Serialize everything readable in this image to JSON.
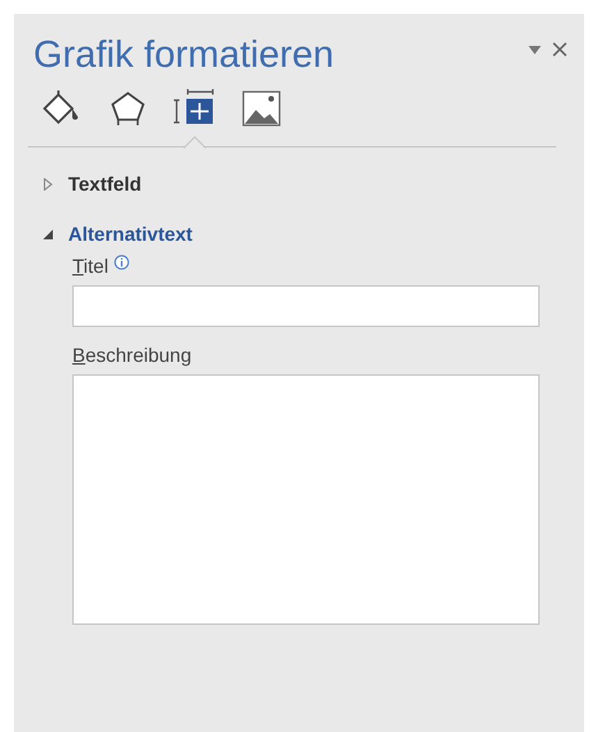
{
  "pane": {
    "title": "Grafik formatieren"
  },
  "tabs": [
    {
      "kind": "fill",
      "selected": false
    },
    {
      "kind": "shape",
      "selected": false
    },
    {
      "kind": "layout",
      "selected": true
    },
    {
      "kind": "picture",
      "selected": false
    }
  ],
  "sections": [
    {
      "label": "Textfeld",
      "expanded": false
    },
    {
      "label": "Alternativtext",
      "expanded": true
    }
  ],
  "fields": [
    {
      "kind": "line",
      "label_key": "T",
      "label_rest": "itel",
      "info": true
    },
    {
      "kind": "area",
      "label_key": "B",
      "label_rest": "eschreibung",
      "info": false
    }
  ]
}
